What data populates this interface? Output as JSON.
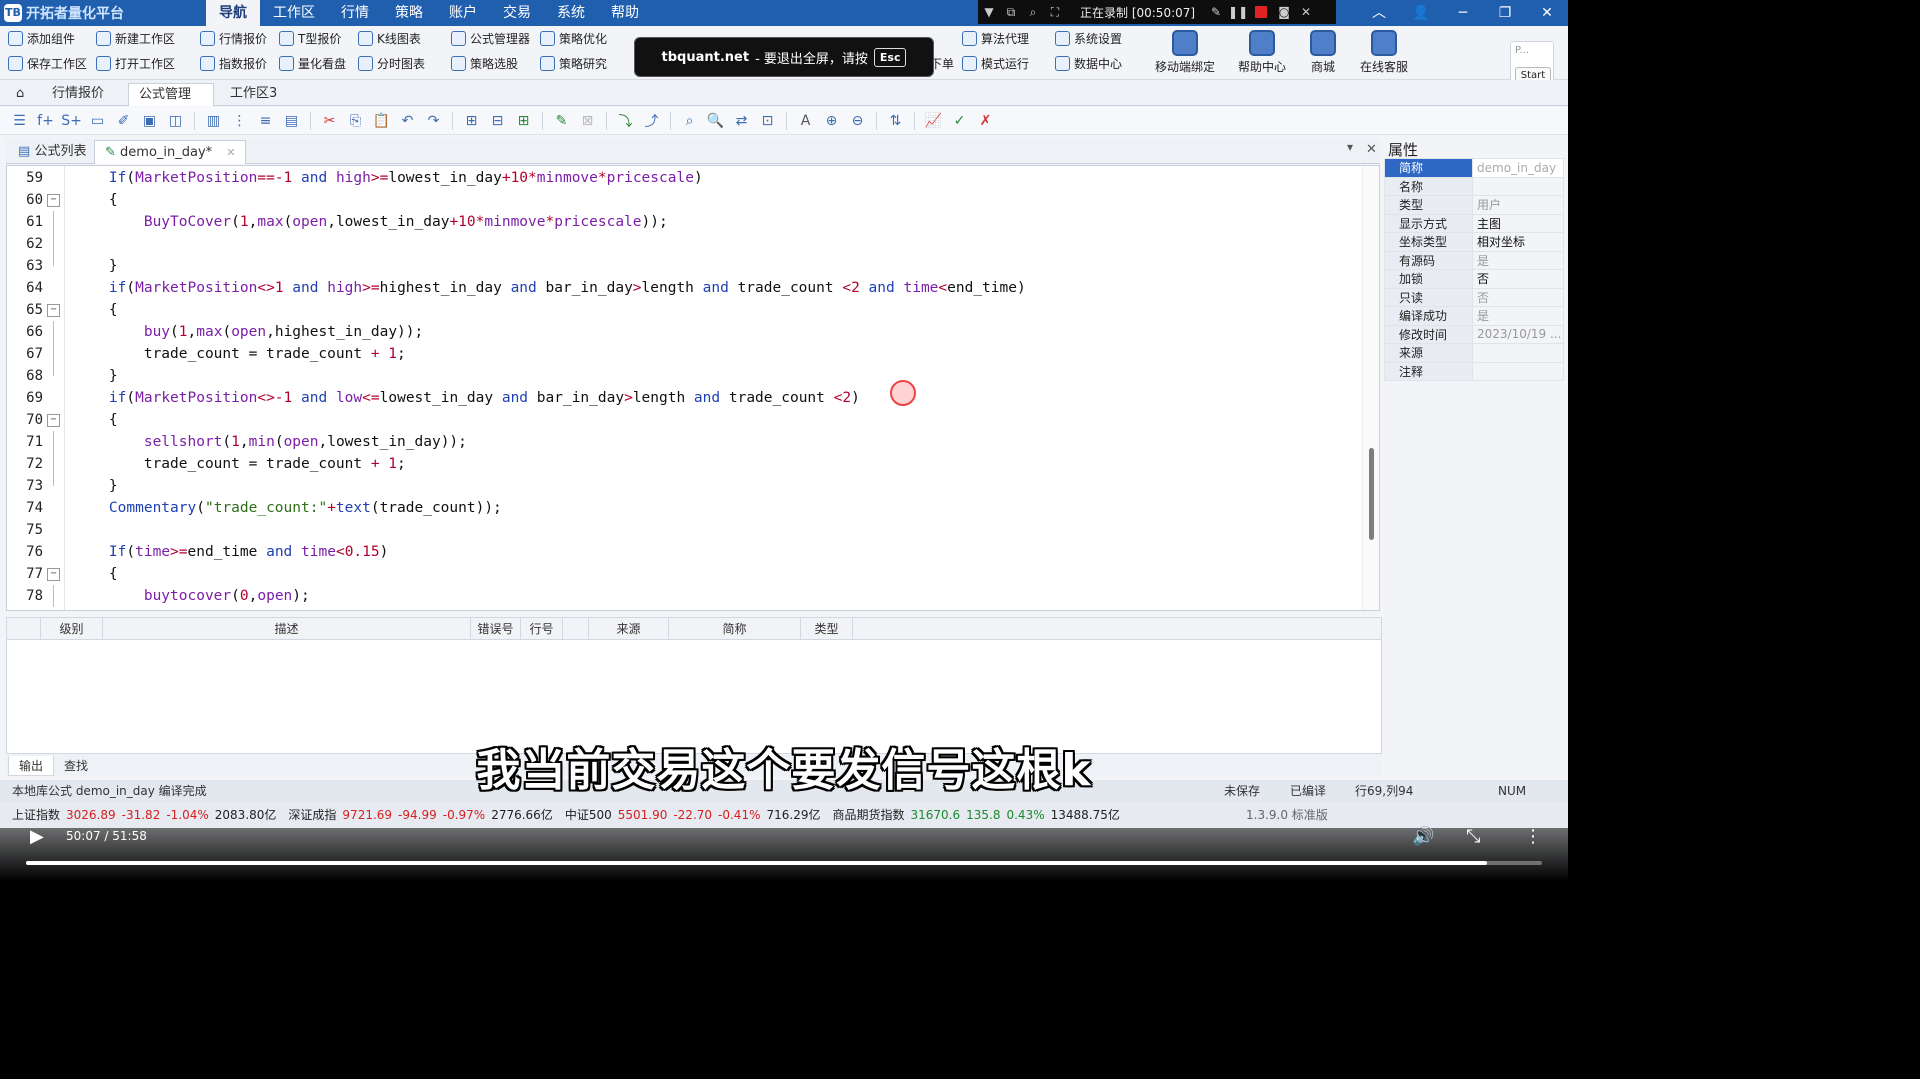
{
  "app": {
    "title": "开拓者量化平台",
    "logo": "TB"
  },
  "menu": [
    "导航",
    "工作区",
    "行情",
    "策略",
    "账户",
    "交易",
    "系统",
    "帮助"
  ],
  "recorder": {
    "status": "正在录制 [00:50:07]"
  },
  "ribbon": {
    "row1": [
      "添加组件",
      "新建工作区",
      "行情报价",
      "T型报价",
      "K线图表",
      "公式管理器",
      "策略优化",
      "算法代理",
      "系统设置"
    ],
    "row2": [
      "保存工作区",
      "打开工作区",
      "指数报价",
      "量化看盘",
      "分时图表",
      "策略选股",
      "策略研究",
      "下单",
      "模式运行",
      "数据中心"
    ],
    "big": [
      "移动端绑定",
      "帮助中心",
      "商城",
      "在线客服"
    ],
    "start_box": {
      "label": "P...",
      "button": "Start"
    }
  },
  "fullscreen_tip": {
    "site": "tbquant.net",
    "text": "- 要退出全屏，请按",
    "key": "Esc"
  },
  "tabs": [
    "行情报价",
    "公式管理",
    "工作区3"
  ],
  "editor_tabs": [
    "公式列表",
    "demo_in_day*"
  ],
  "code_lines": [
    {
      "n": "59",
      "fold": "",
      "tokens": [
        [
          "kw",
          "If"
        ],
        [
          "var",
          "("
        ],
        [
          "fn",
          "MarketPosition"
        ],
        [
          "op",
          "==-"
        ],
        [
          "num",
          "1"
        ],
        [
          "var",
          " "
        ],
        [
          "kw",
          "and"
        ],
        [
          "var",
          " "
        ],
        [
          "fn",
          "high"
        ],
        [
          "op",
          ">="
        ],
        [
          "var",
          "lowest_in_day"
        ],
        [
          "op",
          "+"
        ],
        [
          "num",
          "10"
        ],
        [
          "op",
          "*"
        ],
        [
          "fn",
          "minmove"
        ],
        [
          "op",
          "*"
        ],
        [
          "fn",
          "pricescale"
        ],
        [
          "var",
          ")"
        ]
      ]
    },
    {
      "n": "60",
      "fold": "box",
      "tokens": [
        [
          "var",
          "{"
        ]
      ]
    },
    {
      "n": "61",
      "fold": "line",
      "tokens": [
        [
          "var",
          "    "
        ],
        [
          "fn",
          "BuyToCover"
        ],
        [
          "var",
          "("
        ],
        [
          "num",
          "1"
        ],
        [
          "var",
          ","
        ],
        [
          "fn",
          "max"
        ],
        [
          "var",
          "("
        ],
        [
          "fn",
          "open"
        ],
        [
          "var",
          ",lowest_in_day"
        ],
        [
          "op",
          "+"
        ],
        [
          "num",
          "10"
        ],
        [
          "op",
          "*"
        ],
        [
          "fn",
          "minmove"
        ],
        [
          "op",
          "*"
        ],
        [
          "fn",
          "pricescale"
        ],
        [
          "var",
          "));"
        ]
      ]
    },
    {
      "n": "62",
      "fold": "line",
      "tokens": []
    },
    {
      "n": "63",
      "fold": "end",
      "tokens": [
        [
          "var",
          "}"
        ]
      ]
    },
    {
      "n": "64",
      "fold": "",
      "tokens": [
        [
          "kw",
          "if"
        ],
        [
          "var",
          "("
        ],
        [
          "fn",
          "MarketPosition"
        ],
        [
          "op",
          "<>"
        ],
        [
          "num",
          "1"
        ],
        [
          "var",
          " "
        ],
        [
          "kw",
          "and"
        ],
        [
          "var",
          " "
        ],
        [
          "fn",
          "high"
        ],
        [
          "op",
          ">="
        ],
        [
          "var",
          "highest_in_day "
        ],
        [
          "kw",
          "and"
        ],
        [
          "var",
          " bar_in_day"
        ],
        [
          "op",
          ">"
        ],
        [
          "var",
          "length "
        ],
        [
          "kw",
          "and"
        ],
        [
          "var",
          " trade_count "
        ],
        [
          "op",
          "<"
        ],
        [
          "num",
          "2"
        ],
        [
          "var",
          " "
        ],
        [
          "kw",
          "and"
        ],
        [
          "var",
          " "
        ],
        [
          "fn",
          "time"
        ],
        [
          "op",
          "<"
        ],
        [
          "var",
          "end_time)"
        ]
      ]
    },
    {
      "n": "65",
      "fold": "box",
      "tokens": [
        [
          "var",
          "{"
        ]
      ]
    },
    {
      "n": "66",
      "fold": "line",
      "tokens": [
        [
          "var",
          "    "
        ],
        [
          "fn",
          "buy"
        ],
        [
          "var",
          "("
        ],
        [
          "num",
          "1"
        ],
        [
          "var",
          ","
        ],
        [
          "fn",
          "max"
        ],
        [
          "var",
          "("
        ],
        [
          "fn",
          "open"
        ],
        [
          "var",
          ",highest_in_day));"
        ]
      ]
    },
    {
      "n": "67",
      "fold": "line",
      "tokens": [
        [
          "var",
          "    trade_count = trade_count "
        ],
        [
          "op",
          "+"
        ],
        [
          "var",
          " "
        ],
        [
          "num",
          "1"
        ],
        [
          "var",
          ";"
        ]
      ]
    },
    {
      "n": "68",
      "fold": "end",
      "tokens": [
        [
          "var",
          "}"
        ]
      ]
    },
    {
      "n": "69",
      "fold": "",
      "tokens": [
        [
          "kw",
          "if"
        ],
        [
          "var",
          "("
        ],
        [
          "fn",
          "MarketPosition"
        ],
        [
          "op",
          "<>-"
        ],
        [
          "num",
          "1"
        ],
        [
          "var",
          " "
        ],
        [
          "kw",
          "and"
        ],
        [
          "var",
          " "
        ],
        [
          "fn",
          "low"
        ],
        [
          "op",
          "<="
        ],
        [
          "var",
          "lowest_in_day "
        ],
        [
          "kw",
          "and"
        ],
        [
          "var",
          " bar_in_day"
        ],
        [
          "op",
          ">"
        ],
        [
          "var",
          "length "
        ],
        [
          "kw",
          "and"
        ],
        [
          "var",
          " trade_count "
        ],
        [
          "op",
          "<"
        ],
        [
          "num",
          "2"
        ],
        [
          "var",
          ")"
        ]
      ]
    },
    {
      "n": "70",
      "fold": "box",
      "tokens": [
        [
          "var",
          "{"
        ]
      ]
    },
    {
      "n": "71",
      "fold": "line",
      "tokens": [
        [
          "var",
          "    "
        ],
        [
          "fn",
          "sellshort"
        ],
        [
          "var",
          "("
        ],
        [
          "num",
          "1"
        ],
        [
          "var",
          ","
        ],
        [
          "fn",
          "min"
        ],
        [
          "var",
          "("
        ],
        [
          "fn",
          "open"
        ],
        [
          "var",
          ",lowest_in_day));"
        ]
      ]
    },
    {
      "n": "72",
      "fold": "line",
      "tokens": [
        [
          "var",
          "    trade_count = trade_count "
        ],
        [
          "op",
          "+"
        ],
        [
          "var",
          " "
        ],
        [
          "num",
          "1"
        ],
        [
          "var",
          ";"
        ]
      ]
    },
    {
      "n": "73",
      "fold": "end",
      "tokens": [
        [
          "var",
          "}"
        ]
      ]
    },
    {
      "n": "74",
      "fold": "",
      "tokens": [
        [
          "kw",
          "Commentary"
        ],
        [
          "var",
          "("
        ],
        [
          "str",
          "\"trade_count:\""
        ],
        [
          "op",
          "+"
        ],
        [
          "kw",
          "text"
        ],
        [
          "var",
          "(trade_count));"
        ]
      ]
    },
    {
      "n": "75",
      "fold": "",
      "tokens": []
    },
    {
      "n": "76",
      "fold": "",
      "tokens": [
        [
          "kw",
          "If"
        ],
        [
          "var",
          "("
        ],
        [
          "fn",
          "time"
        ],
        [
          "op",
          ">="
        ],
        [
          "var",
          "end_time "
        ],
        [
          "kw",
          "and"
        ],
        [
          "var",
          " "
        ],
        [
          "fn",
          "time"
        ],
        [
          "op",
          "<"
        ],
        [
          "num",
          "0.15"
        ],
        [
          "var",
          ")"
        ]
      ]
    },
    {
      "n": "77",
      "fold": "box",
      "tokens": [
        [
          "var",
          "{"
        ]
      ]
    },
    {
      "n": "78",
      "fold": "line",
      "tokens": [
        [
          "var",
          "    "
        ],
        [
          "fn",
          "buytocover"
        ],
        [
          "var",
          "("
        ],
        [
          "num",
          "0"
        ],
        [
          "var",
          ","
        ],
        [
          "fn",
          "open"
        ],
        [
          "var",
          ");"
        ]
      ]
    }
  ],
  "properties": {
    "title": "属性",
    "rows": [
      {
        "k": "简称",
        "v": "demo_in_day",
        "style": "sel"
      },
      {
        "k": "名称",
        "v": "",
        "style": ""
      },
      {
        "k": "类型",
        "v": "用户",
        "style": ""
      },
      {
        "k": "显示方式",
        "v": "主图",
        "style": "b"
      },
      {
        "k": "坐标类型",
        "v": "相对坐标",
        "style": "b"
      },
      {
        "k": "有源码",
        "v": "是",
        "style": ""
      },
      {
        "k": "加锁",
        "v": "否",
        "style": "b"
      },
      {
        "k": "只读",
        "v": "否",
        "style": ""
      },
      {
        "k": "编译成功",
        "v": "是",
        "style": ""
      },
      {
        "k": "修改时间",
        "v": "2023/10/19 ...",
        "style": ""
      },
      {
        "k": "来源",
        "v": "",
        "style": ""
      },
      {
        "k": "注释",
        "v": "",
        "style": ""
      }
    ]
  },
  "output_headers": [
    "级别",
    "描述",
    "错误号",
    "行号",
    "来源",
    "简称",
    "类型"
  ],
  "output_tabs": [
    "输出",
    "查找"
  ],
  "status": {
    "message": "本地库公式 demo_in_day 编译完成",
    "save": "未保存",
    "compiled": "已编译",
    "pos": "行69,列94",
    "num": "NUM"
  },
  "ticker": [
    {
      "name": "上证指数",
      "vals": [
        "3026.89",
        "-31.82",
        "-1.04%",
        "2083.80亿"
      ],
      "dir": "dn"
    },
    {
      "name": "深证成指",
      "vals": [
        "9721.69",
        "-94.99",
        "-0.97%",
        "2776.66亿"
      ],
      "dir": "dn"
    },
    {
      "name": "中证500",
      "vals": [
        "5501.90",
        "-22.70",
        "-0.41%",
        "716.29亿"
      ],
      "dir": "dn"
    },
    {
      "name": "商品期货指数",
      "vals": [
        "31670.6",
        "135.8",
        "0.43%",
        "13488.75亿"
      ],
      "dir": "up"
    }
  ],
  "version": "1.3.9.0 标准版",
  "subtitle": "我当前交易这个要发信号这根k",
  "video": {
    "time": "50:07 / 51:58",
    "progress": 0.964
  }
}
